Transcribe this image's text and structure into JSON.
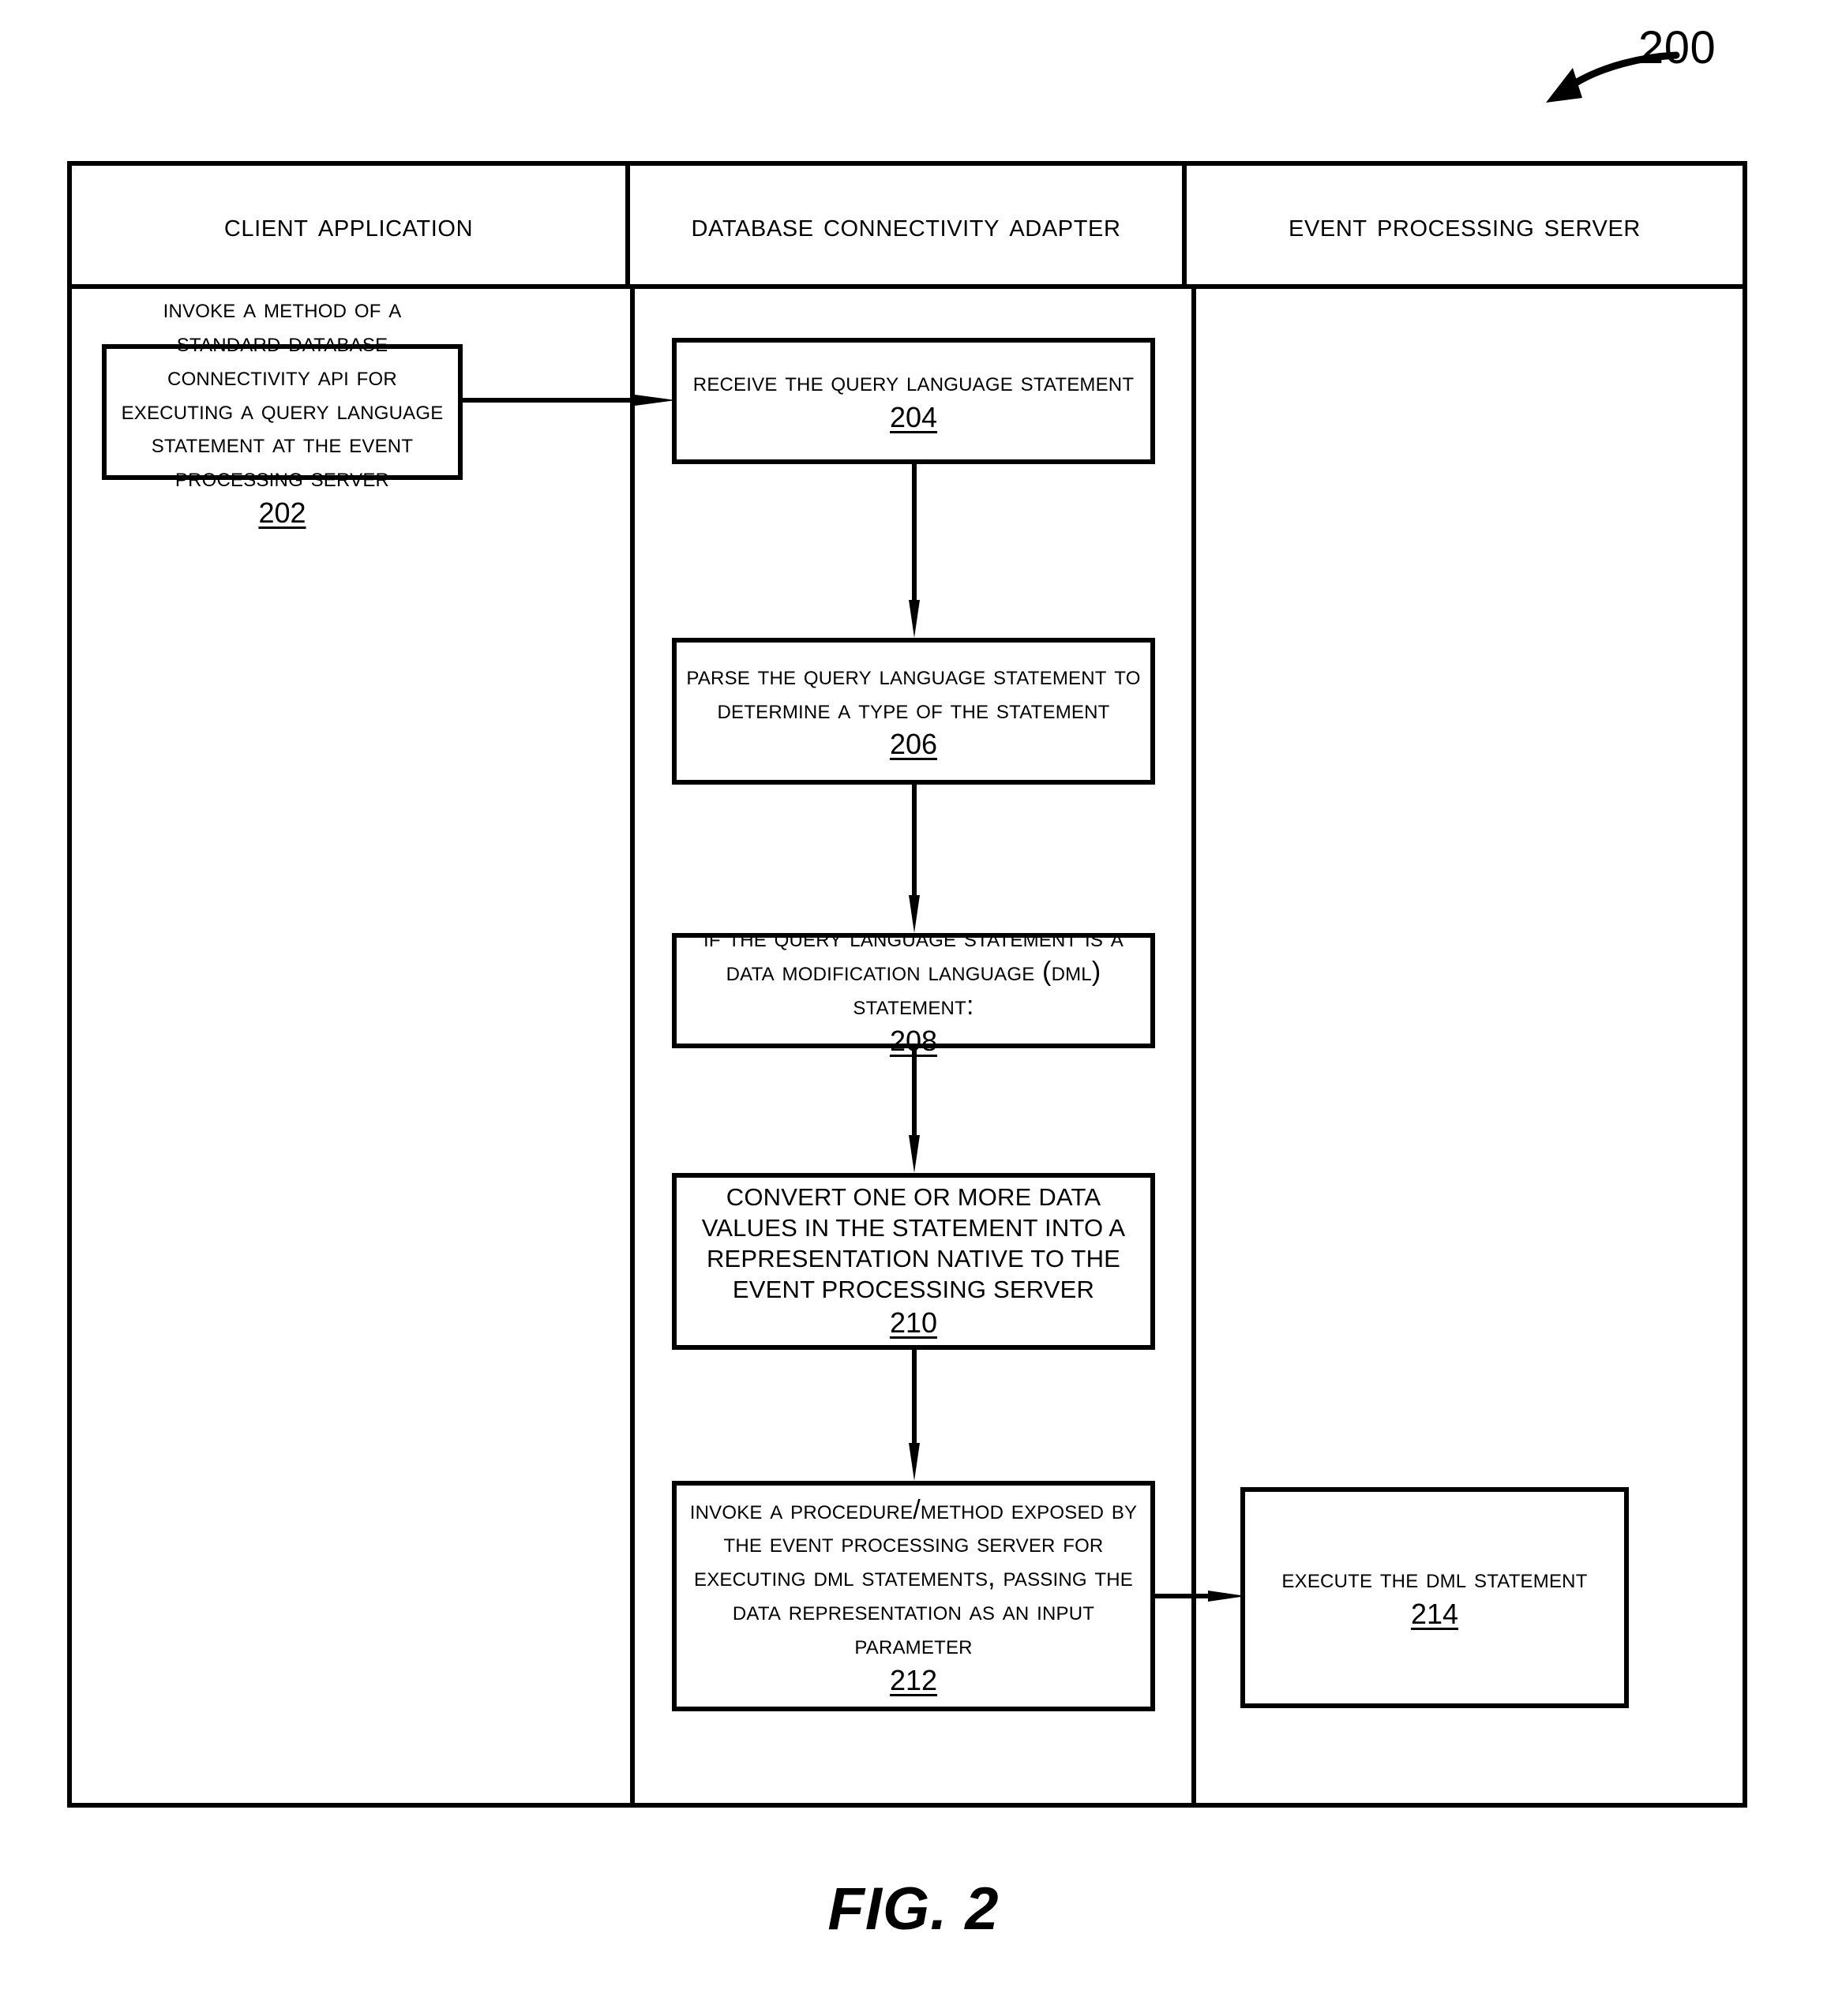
{
  "figure": {
    "caption": "FIG. 2",
    "reference_numeral": "200"
  },
  "lanes": [
    {
      "id": "client-application",
      "header": "Client Application"
    },
    {
      "id": "database-connectivity-adapter",
      "header": "Database Connectivity Adapter"
    },
    {
      "id": "event-processing-server",
      "header": "Event Processing Server"
    }
  ],
  "steps": [
    {
      "num": "202",
      "lane": "client-application",
      "text": "Invoke a method of a standard database connectivity API for executing a query language statement at the event processing server"
    },
    {
      "num": "204",
      "lane": "database-connectivity-adapter",
      "text": "Receive the query language statement"
    },
    {
      "num": "206",
      "lane": "database-connectivity-adapter",
      "text": "Parse the query language statement to determine a type of the statement"
    },
    {
      "num": "208",
      "lane": "database-connectivity-adapter",
      "text": "If the query language statement is a data modification language (DML) statement:"
    },
    {
      "num": "210",
      "lane": "database-connectivity-adapter",
      "text": "Convert one or more data values in the statement into a representation native to the event processing server"
    },
    {
      "num": "212",
      "lane": "database-connectivity-adapter",
      "text": "Invoke a procedure/method exposed by the event processing server for executing DML statements, passing the data representation as an input parameter"
    },
    {
      "num": "214",
      "lane": "event-processing-server",
      "text": "Execute the DML statement"
    }
  ],
  "connectors": [
    {
      "from": "202",
      "to": "204",
      "direction": "right"
    },
    {
      "from": "204",
      "to": "206",
      "direction": "down"
    },
    {
      "from": "206",
      "to": "208",
      "direction": "down"
    },
    {
      "from": "208",
      "to": "210",
      "direction": "down"
    },
    {
      "from": "210",
      "to": "212",
      "direction": "down"
    },
    {
      "from": "212",
      "to": "214",
      "direction": "right"
    }
  ],
  "colors": {
    "ink": "#000000",
    "paper": "#ffffff"
  }
}
